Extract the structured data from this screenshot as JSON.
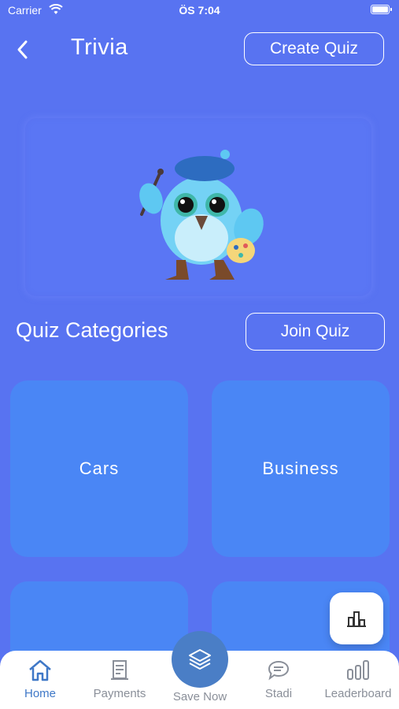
{
  "status_bar": {
    "carrier": "Carrier",
    "time": "ÖS 7:04"
  },
  "header": {
    "title": "Trivia",
    "create_quiz_label": "Create Quiz"
  },
  "categories_section": {
    "title": "Quiz Categories",
    "join_quiz_label": "Join Quiz",
    "cards": [
      {
        "label": "Cars"
      },
      {
        "label": "Business"
      },
      {
        "label": ""
      },
      {
        "label": ""
      }
    ]
  },
  "tab_bar": {
    "items": [
      {
        "label": "Home",
        "icon": "home-icon",
        "active": true
      },
      {
        "label": "Payments",
        "icon": "receipt-icon",
        "active": false
      },
      {
        "label": "Save Now",
        "icon": "layers-icon",
        "active": false
      },
      {
        "label": "Stadi",
        "icon": "chat-icon",
        "active": false
      },
      {
        "label": "Leaderboard",
        "icon": "bar-chart-icon",
        "active": false
      }
    ]
  },
  "colors": {
    "background": "#5873f1",
    "card": "#4a86f5",
    "active_tab": "#3f78c7",
    "tab_inactive": "#8a8f99",
    "save_button": "#4a7ec6"
  }
}
